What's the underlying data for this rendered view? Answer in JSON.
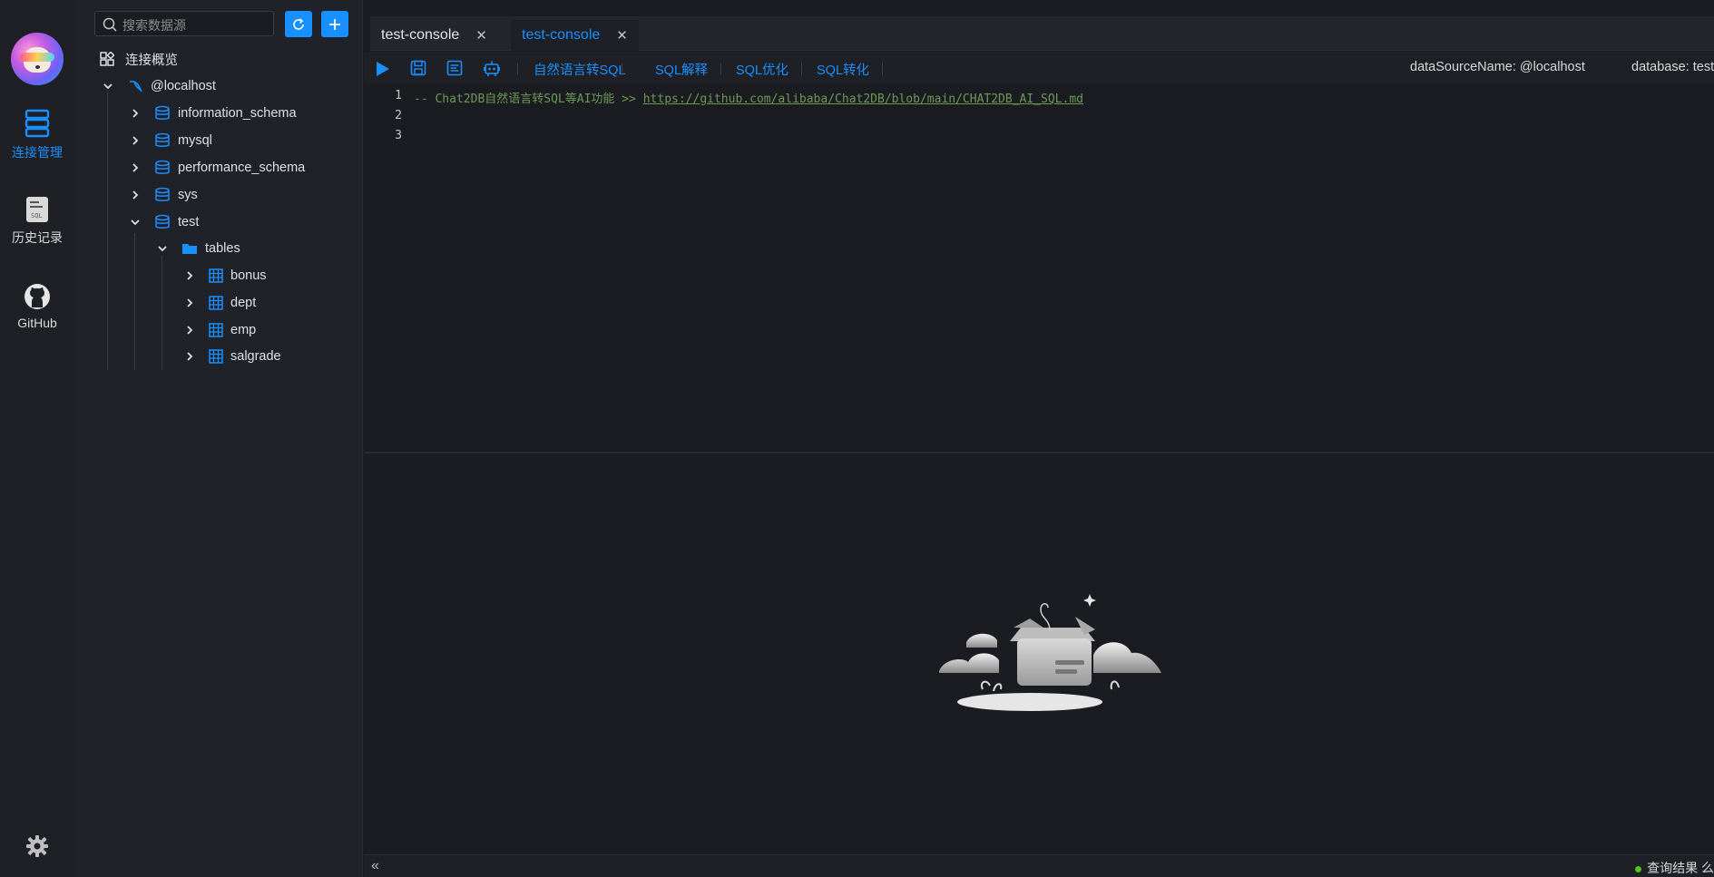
{
  "rail": {
    "items": [
      {
        "label": "连接管理",
        "icon": "database-stack-icon",
        "active": true
      },
      {
        "label": "历史记录",
        "icon": "sql-file-icon",
        "active": false
      },
      {
        "label": "GitHub",
        "icon": "github-icon",
        "active": false
      }
    ],
    "settings_icon": "gear-icon"
  },
  "tree": {
    "search_placeholder": "搜索数据源",
    "overview_label": "连接概览",
    "connection": "@localhost",
    "databases": [
      "information_schema",
      "mysql",
      "performance_schema",
      "sys",
      "test"
    ],
    "folder": "tables",
    "tables": [
      "bonus",
      "dept",
      "emp",
      "salgrade"
    ]
  },
  "tabs": [
    {
      "label": "test-console",
      "active": false
    },
    {
      "label": "test-console",
      "active": true
    }
  ],
  "toolbar": {
    "links": [
      "自然语言转SQL",
      "SQL解释",
      "SQL优化",
      "SQL转化"
    ],
    "datasource": "dataSourceName: @localhost",
    "database": "database: test"
  },
  "editor": {
    "line_numbers": [
      "1",
      "2",
      "3"
    ],
    "line1_comment": "-- Chat2DB自然语言转SQL等AI功能 >> ",
    "line1_link": "https://github.com/alibaba/Chat2DB/blob/main/CHAT2DB_AI_SQL.md"
  },
  "status": {
    "collapse_glyph": "«",
    "result_label": "查询结果 么"
  },
  "colors": {
    "accent": "#1890ff",
    "comment": "#6a9955",
    "success": "#52c41a"
  }
}
